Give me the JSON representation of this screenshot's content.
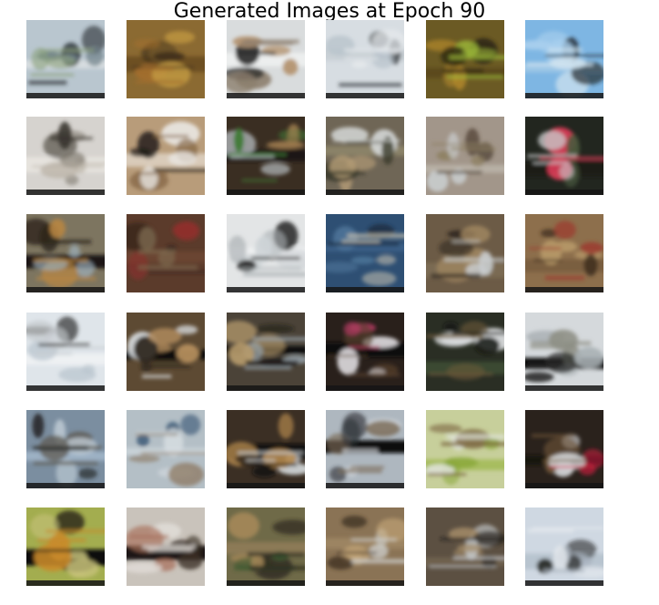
{
  "figure": {
    "title": "Generated Images at Epoch 90"
  },
  "grid": {
    "rows": 6,
    "cols": 6,
    "tiles": [
      {
        "name": "sample-1",
        "bg": "#b9c6cf",
        "c1": "#6b7d86",
        "c2": "#2c3338",
        "c3": "#8aa07a",
        "band": "#d7dde0",
        "tone": "light"
      },
      {
        "name": "sample-2",
        "bg": "#8b6a32",
        "c1": "#c39a42",
        "c2": "#3e2f19",
        "c3": "#a36e2e",
        "band": "#6d4f22",
        "tone": "warm"
      },
      {
        "name": "sample-3",
        "bg": "#d9dcdd",
        "c1": "#b49370",
        "c2": "#232323",
        "c3": "#8c7e6d",
        "band": "#eceeee",
        "tone": "light"
      },
      {
        "name": "sample-4",
        "bg": "#d7dde2",
        "c1": "#b7c2cb",
        "c2": "#2b2f32",
        "c3": "#e6e9ec",
        "band": "#c9d0d5",
        "tone": "light"
      },
      {
        "name": "sample-5",
        "bg": "#6b5a24",
        "c1": "#b58b2c",
        "c2": "#2f2a14",
        "c3": "#9dbb3a",
        "band": "#5c4a1d",
        "tone": "warm"
      },
      {
        "name": "sample-6",
        "bg": "#7eb6e3",
        "c1": "#a9cfee",
        "c2": "#1f2326",
        "c3": "#cfe2ef",
        "band": "#9cc6e6",
        "tone": "sky"
      },
      {
        "name": "sample-7",
        "bg": "#d6d3cf",
        "c1": "#7d776d",
        "c2": "#3b3630",
        "c3": "#b9b2a6",
        "band": "#e6e3de",
        "tone": "light"
      },
      {
        "name": "sample-8",
        "bg": "#b89c7a",
        "c1": "#e9e6e2",
        "c2": "#1f1b17",
        "c3": "#7a5b3a",
        "band": "#d9cbb9",
        "tone": "warm"
      },
      {
        "name": "sample-9",
        "bg": "#3a2e22",
        "c1": "#9c7a4d",
        "c2": "#c9d2d8",
        "c3": "#3f7a35",
        "band": "#1d1814",
        "tone": "dark"
      },
      {
        "name": "sample-10",
        "bg": "#6f6656",
        "c1": "#b59d76",
        "c2": "#d6dad9",
        "c3": "#3a3a2c",
        "band": "#8a8268",
        "tone": "warm"
      },
      {
        "name": "sample-11",
        "bg": "#a2968a",
        "c1": "#cfd5d8",
        "c2": "#4a3d2f",
        "c3": "#8b7e5e",
        "band": "#b8b0a5",
        "tone": "light"
      },
      {
        "name": "sample-12",
        "bg": "#22261f",
        "c1": "#4c5a3e",
        "c2": "#d63a55",
        "c3": "#c8c9cb",
        "band": "#1a1c18",
        "tone": "dark"
      },
      {
        "name": "sample-13",
        "bg": "#7d7560",
        "c1": "#a2b7c5",
        "c2": "#2a2218",
        "c3": "#b88642",
        "band": "#1b1612",
        "tone": "warm"
      },
      {
        "name": "sample-14",
        "bg": "#5b3b2b",
        "c1": "#8e2f2b",
        "c2": "#2e2019",
        "c3": "#7d6a4f",
        "band": "#6a4530",
        "tone": "dark"
      },
      {
        "name": "sample-15",
        "bg": "#e3e5e6",
        "c1": "#cfd4d7",
        "c2": "#1e1e1d",
        "c3": "#aab0b3",
        "band": "#eef0f1",
        "tone": "light"
      },
      {
        "name": "sample-16",
        "bg": "#2e4f73",
        "c1": "#4d7498",
        "c2": "#1b2a3a",
        "c3": "#c9c2b0",
        "band": "#3a5f86",
        "tone": "blue"
      },
      {
        "name": "sample-17",
        "bg": "#6c5b46",
        "c1": "#a48a63",
        "c2": "#2d261e",
        "c3": "#c9cdcf",
        "band": "#7a6a52",
        "tone": "warm"
      },
      {
        "name": "sample-18",
        "bg": "#8d6f4c",
        "c1": "#b79968",
        "c2": "#3b2c1e",
        "c3": "#9c3a2e",
        "band": "#7a5e3f",
        "tone": "warm"
      },
      {
        "name": "sample-19",
        "bg": "#dfe5ea",
        "c1": "#b8c4cd",
        "c2": "#272421",
        "c3": "#c6ccd0",
        "band": "#eef1f3",
        "tone": "light"
      },
      {
        "name": "sample-20",
        "bg": "#5d4a33",
        "c1": "#b89160",
        "c2": "#d9dde0",
        "c3": "#2a221a",
        "band": "#0e0e0e",
        "tone": "warm"
      },
      {
        "name": "sample-21",
        "bg": "#4b4338",
        "c1": "#b89c6d",
        "c2": "#1b1a19",
        "c3": "#9aa7b0",
        "band": "#0f0f0f",
        "tone": "dark"
      },
      {
        "name": "sample-22",
        "bg": "#29201b",
        "c1": "#d8d4d8",
        "c2": "#c23a6a",
        "c3": "#57402c",
        "band": "#0f0c0a",
        "tone": "dark"
      },
      {
        "name": "sample-23",
        "bg": "#2a2e24",
        "c1": "#e4e6e8",
        "c2": "#141513",
        "c3": "#6e5a3a",
        "band": "#3b4a32",
        "tone": "dark"
      },
      {
        "name": "sample-24",
        "bg": "#d5d9dc",
        "c1": "#a9b0b4",
        "c2": "#2a2b2a",
        "c3": "#8d8f84",
        "band": "#0d0d0d",
        "tone": "light"
      },
      {
        "name": "sample-25",
        "bg": "#7b8ea0",
        "c1": "#c4d0d9",
        "c2": "#2b2d2f",
        "c3": "#5e5b53",
        "band": "#9db1c4",
        "tone": "blue"
      },
      {
        "name": "sample-26",
        "bg": "#b4bfc6",
        "c1": "#2d4d6e",
        "c2": "#d9dfe3",
        "c3": "#8e7b65",
        "band": "#c8d1d7",
        "tone": "light"
      },
      {
        "name": "sample-27",
        "bg": "#3b2f24",
        "c1": "#b78b4f",
        "c2": "#0e0e0e",
        "c3": "#cfd3d5",
        "band": "#0b0b0b",
        "tone": "dark"
      },
      {
        "name": "sample-28",
        "bg": "#aeb7bf",
        "c1": "#2a2d33",
        "c2": "#d8dde1",
        "c3": "#7a6a55",
        "band": "#0d0d0d",
        "tone": "light"
      },
      {
        "name": "sample-29",
        "bg": "#c7cf9b",
        "c1": "#8aa83a",
        "c2": "#e2e5df",
        "c3": "#7a6540",
        "band": "#a7bd5e",
        "tone": "green"
      },
      {
        "name": "sample-30",
        "bg": "#2a221c",
        "c1": "#d7d9db",
        "c2": "#c7203e",
        "c3": "#6f5638",
        "band": "#151210",
        "tone": "dark"
      },
      {
        "name": "sample-31",
        "bg": "#a3ad4f",
        "c1": "#c7c27a",
        "c2": "#2a2418",
        "c3": "#c98a2a",
        "band": "#0f0f0f",
        "tone": "green"
      },
      {
        "name": "sample-32",
        "bg": "#c9c3bb",
        "c1": "#3a2f26",
        "c2": "#a8715c",
        "c3": "#e1ddd8",
        "band": "#1c1612",
        "tone": "light"
      },
      {
        "name": "sample-33",
        "bg": "#6f6a48",
        "c1": "#a88a5a",
        "c2": "#3d5a2e",
        "c3": "#2a261f",
        "band": "#8c7a56",
        "tone": "warm"
      },
      {
        "name": "sample-34",
        "bg": "#8a7355",
        "c1": "#c8aa7a",
        "c2": "#3e3023",
        "c3": "#d1d4d4",
        "band": "#9c8462",
        "tone": "warm"
      },
      {
        "name": "sample-35",
        "bg": "#5c5042",
        "c1": "#a28a66",
        "c2": "#1f1b17",
        "c3": "#c4c8ca",
        "band": "#6e604e",
        "tone": "warm"
      },
      {
        "name": "sample-36",
        "bg": "#cfd8e2",
        "c1": "#1d1c1a",
        "c2": "#a9b4bf",
        "c3": "#e5e9ee",
        "band": "#b8c4cf",
        "tone": "light"
      }
    ]
  }
}
